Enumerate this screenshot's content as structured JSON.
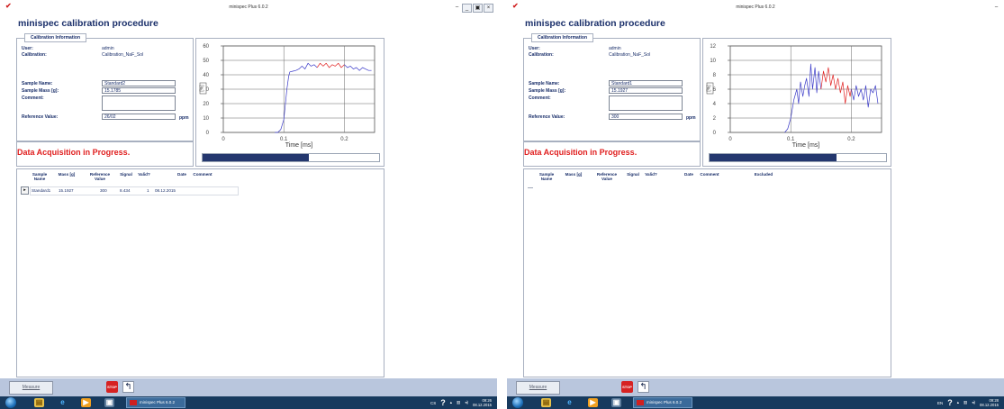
{
  "screens": [
    {
      "window_title": "minispec Plus 6.0.2",
      "title": "minispec calibration procedure",
      "calib_info": {
        "legend": "Calibration Information",
        "user_label": "User:",
        "user_value": "admin",
        "calibration_label": "Calibration:",
        "calibration_value": "Calibration_NaF_Sol",
        "sample_name_label": "Sample Name:",
        "sample_name_value": "Standard2",
        "sample_mass_label": "Sample Mass [g]:",
        "sample_mass_value": "15.1785",
        "comment_label": "Comment:",
        "comment_value": "",
        "reference_label": "Reference Value:",
        "reference_value": "26/02",
        "reference_unit": "ppm"
      },
      "status": "Data Acquisition in Progress.",
      "chart_data": {
        "type": "line",
        "xlabel": "Time [ms]",
        "ylabel": "[%]",
        "xlim": [
          0,
          0.25
        ],
        "ylim": [
          0,
          60
        ],
        "xticks": [
          "0",
          "0.1",
          "0.2"
        ],
        "yticks": [
          "0",
          "10",
          "20",
          "30",
          "40",
          "50",
          "60"
        ],
        "grid": true,
        "series": [
          {
            "color": "#3a3ac8",
            "x": [
              0.085,
              0.09,
              0.095,
              0.1,
              0.105,
              0.108,
              0.11,
              0.115,
              0.12,
              0.125,
              0.13,
              0.135,
              0.14,
              0.145,
              0.15,
              0.155
            ],
            "y": [
              0,
              0,
              2,
              9,
              30,
              39,
              42,
              42.5,
              43,
              44,
              46,
              44,
              48,
              46,
              47,
              45
            ]
          },
          {
            "color": "#e02020",
            "x": [
              0.155,
              0.16,
              0.165,
              0.17,
              0.175,
              0.18,
              0.185,
              0.19,
              0.195,
              0.2
            ],
            "y": [
              45,
              48,
              46,
              48,
              45,
              47,
              46,
              48,
              45,
              47
            ]
          },
          {
            "color": "#3a3ac8",
            "x": [
              0.2,
              0.205,
              0.21,
              0.215,
              0.22,
              0.225,
              0.23,
              0.235,
              0.24,
              0.245
            ],
            "y": [
              47,
              45,
              46,
              44,
              45,
              43,
              45,
              44,
              43,
              43
            ]
          }
        ]
      },
      "progress": 0.6,
      "table": {
        "headers": [
          "Sample Name",
          "Mass [g]",
          "Reference Value",
          "Signal",
          "Valid?",
          "Date",
          "Comment"
        ],
        "rows": [
          {
            "marker": "▸",
            "cells": [
              "Standard1",
              "15.1927",
              "300",
              "8.434",
              "1",
              "08.12.2015",
              ""
            ]
          }
        ]
      },
      "toolbar": {
        "measure_label": "Measure",
        "stop_label": "STOP"
      },
      "taskbar": {
        "task_label": "minispec Plus 6.0.2",
        "lang": "CS",
        "time": "09:26",
        "date": "08.12.2015"
      }
    },
    {
      "window_title": "minispec Plus 6.0.2",
      "title": "minispec calibration procedure",
      "calib_info": {
        "legend": "Calibration Information",
        "user_label": "User:",
        "user_value": "admin",
        "calibration_label": "Calibration:",
        "calibration_value": "Calibration_NaF_Sol",
        "sample_name_label": "Sample Name:",
        "sample_name_value": "Standard1",
        "sample_mass_label": "Sample Mass [g]:",
        "sample_mass_value": "15.1927",
        "comment_label": "Comment:",
        "comment_value": "",
        "reference_label": "Reference Value:",
        "reference_value": "300",
        "reference_unit": "ppm"
      },
      "status": "Data Acquisition in Progress.",
      "chart_data": {
        "type": "line",
        "xlabel": "Time [ms]",
        "ylabel": "[%]",
        "xlim": [
          0,
          0.25
        ],
        "ylim": [
          0,
          12
        ],
        "xticks": [
          "0",
          "0.1",
          "0.2"
        ],
        "yticks": [
          "0",
          "2",
          "4",
          "6",
          "8",
          "10",
          "12"
        ],
        "grid": true,
        "series": [
          {
            "color": "#3a3ac8",
            "x": [
              0.09,
              0.095,
              0.1,
              0.105,
              0.11,
              0.113,
              0.116,
              0.12,
              0.123,
              0.126,
              0.13,
              0.133,
              0.136,
              0.14,
              0.143,
              0.146,
              0.15
            ],
            "y": [
              0,
              0.5,
              2,
              4.5,
              6,
              4,
              7,
              5,
              6.5,
              7.5,
              5,
              9.5,
              6,
              9,
              5.5,
              8.5,
              6
            ]
          },
          {
            "color": "#e02020",
            "x": [
              0.15,
              0.154,
              0.158,
              0.162,
              0.166,
              0.17,
              0.174,
              0.178,
              0.182,
              0.186,
              0.19,
              0.194,
              0.198,
              0.2
            ],
            "y": [
              6,
              8.5,
              7,
              9,
              6.5,
              8,
              6,
              7.5,
              5.5,
              7,
              4,
              6.5,
              5,
              6
            ]
          },
          {
            "color": "#3a3ac8",
            "x": [
              0.2,
              0.204,
              0.208,
              0.212,
              0.216,
              0.22,
              0.224,
              0.228,
              0.232,
              0.236,
              0.24,
              0.244
            ],
            "y": [
              6,
              4.5,
              6.5,
              5,
              6,
              4.5,
              6.5,
              3.5,
              6,
              5.5,
              6.5,
              4
            ]
          }
        ]
      },
      "progress": 0.72,
      "table": {
        "headers": [
          "Sample Name",
          "Mass [g]",
          "Reference Value",
          "Signal",
          "Valid?",
          "Date",
          "Comment",
          "Excluded"
        ],
        "rows": [
          {
            "marker": "",
            "cells": []
          }
        ]
      },
      "toolbar": {
        "measure_label": "Measure",
        "stop_label": "STOP"
      },
      "taskbar": {
        "task_label": "minispec Plus 6.0.2",
        "lang": "EN",
        "time": "09:28",
        "date": "08.12.2015"
      }
    }
  ]
}
